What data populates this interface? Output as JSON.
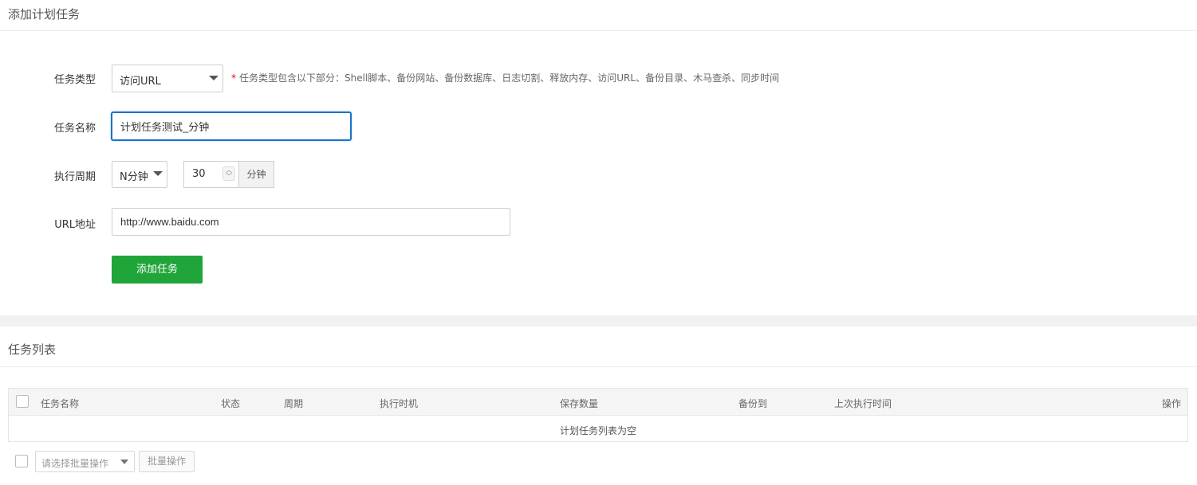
{
  "add_section": {
    "title": "添加计划任务",
    "task_type": {
      "label": "任务类型",
      "selected": "访问URL",
      "tip": "任务类型包含以下部分：Shell脚本、备份网站、备份数据库、日志切割、释放内存、访问URL、备份目录、木马查杀、同步时间",
      "required_mark": "*"
    },
    "task_name": {
      "label": "任务名称",
      "value": "计划任务测试_分钟"
    },
    "cycle": {
      "label": "执行周期",
      "selected": "N分钟",
      "number_value": "30",
      "unit": "分钟"
    },
    "url": {
      "label": "URL地址",
      "value": "http://www.baidu.com"
    },
    "submit_label": "添加任务"
  },
  "list_section": {
    "title": "任务列表",
    "columns": [
      "任务名称",
      "状态",
      "周期",
      "执行时机",
      "保存数量",
      "备份到",
      "上次执行时间",
      "操作"
    ],
    "empty_message": "计划任务列表为空",
    "batch_select_placeholder": "请选择批量操作",
    "batch_button_label": "批量操作"
  },
  "colors": {
    "accent_green": "#20a53a",
    "focus_blue": "#1a73c8",
    "required_red": "#e60012"
  },
  "icons": {
    "dropdown": "caret-down-icon",
    "spinner": "spinner-arrows-icon"
  }
}
